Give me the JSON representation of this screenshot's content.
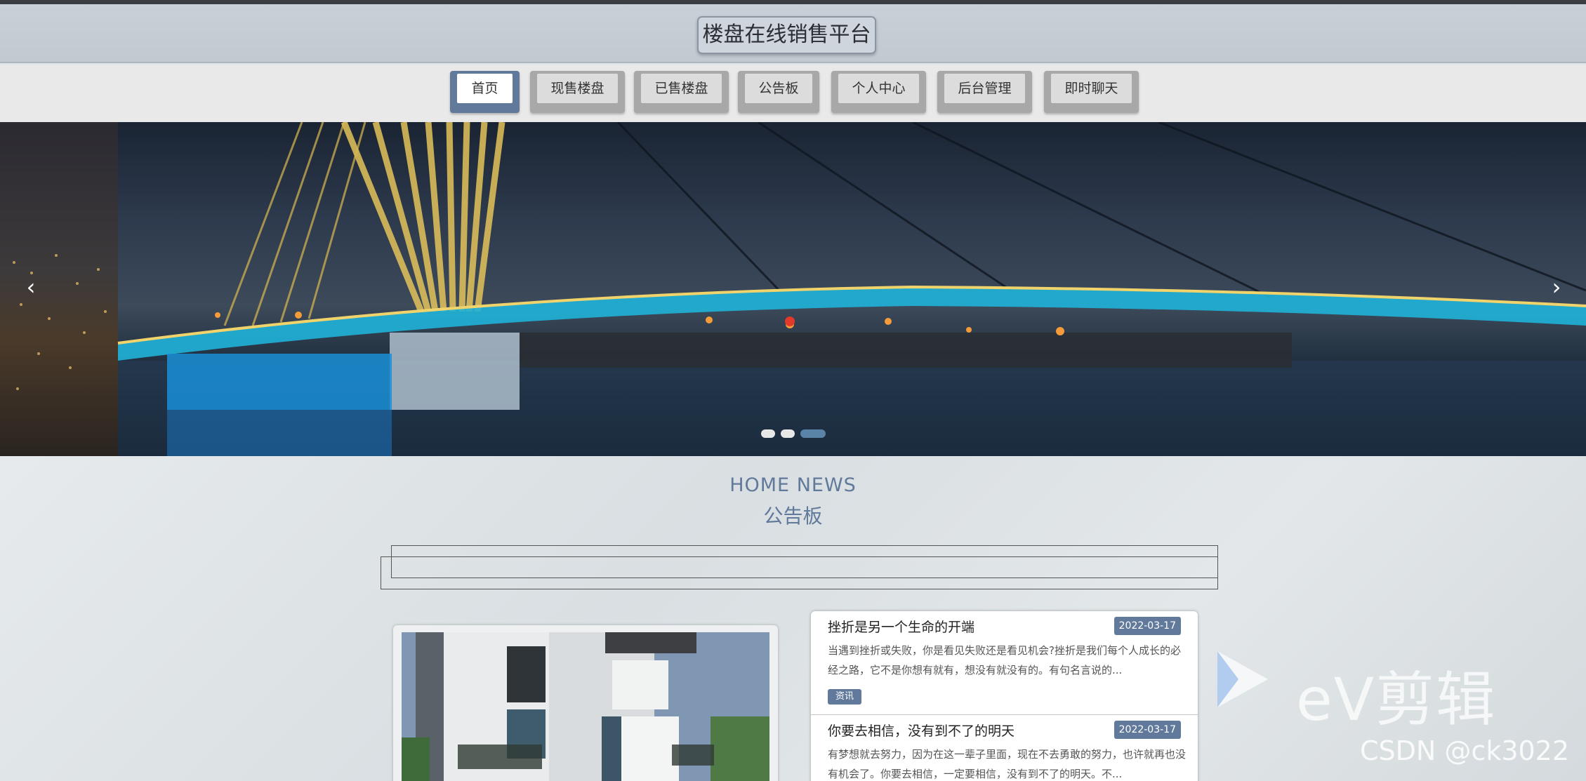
{
  "header": {
    "site_title": "楼盘在线销售平台"
  },
  "nav": {
    "items": [
      {
        "label": "首页",
        "active": true
      },
      {
        "label": "现售楼盘",
        "active": false
      },
      {
        "label": "已售楼盘",
        "active": false
      },
      {
        "label": "公告板",
        "active": false
      },
      {
        "label": "个人中心",
        "active": false
      },
      {
        "label": "后台管理",
        "active": false
      },
      {
        "label": "即时聊天",
        "active": false
      }
    ]
  },
  "banner": {
    "prev_icon": "chevron-left-icon",
    "next_icon": "chevron-right-icon",
    "prev_glyph": "‹",
    "next_glyph": "›",
    "slide_count": 3,
    "active_slide": 3
  },
  "home_news": {
    "title_en": "HOME NEWS",
    "title_cn": "公告板",
    "items": [
      {
        "title": "挫折是另一个生命的开端",
        "date": "2022-03-17",
        "desc": "当遇到挫折或失败，你是看见失败还是看见机会?挫折是我们每个人成长的必经之路，它不是你想有就有，想没有就没有的。有句名言说的...",
        "tag": "资讯"
      },
      {
        "title": "你要去相信，没有到不了的明天",
        "date": "2022-03-17",
        "desc": "有梦想就去努力，因为在这一辈子里面，现在不去勇敢的努力，也许就再也没有机会了。你要去相信，一定要相信，没有到不了的明天。不...",
        "tag": ""
      }
    ]
  },
  "watermarks": {
    "editor_logo": "ev-logo-icon",
    "editor_text": "eV剪辑",
    "csdn_text": "CSDN @ck3022"
  },
  "colors": {
    "accent": "#61799a",
    "header_bg": "#c6cdd4",
    "nav_bg": "#e9e9e9"
  }
}
